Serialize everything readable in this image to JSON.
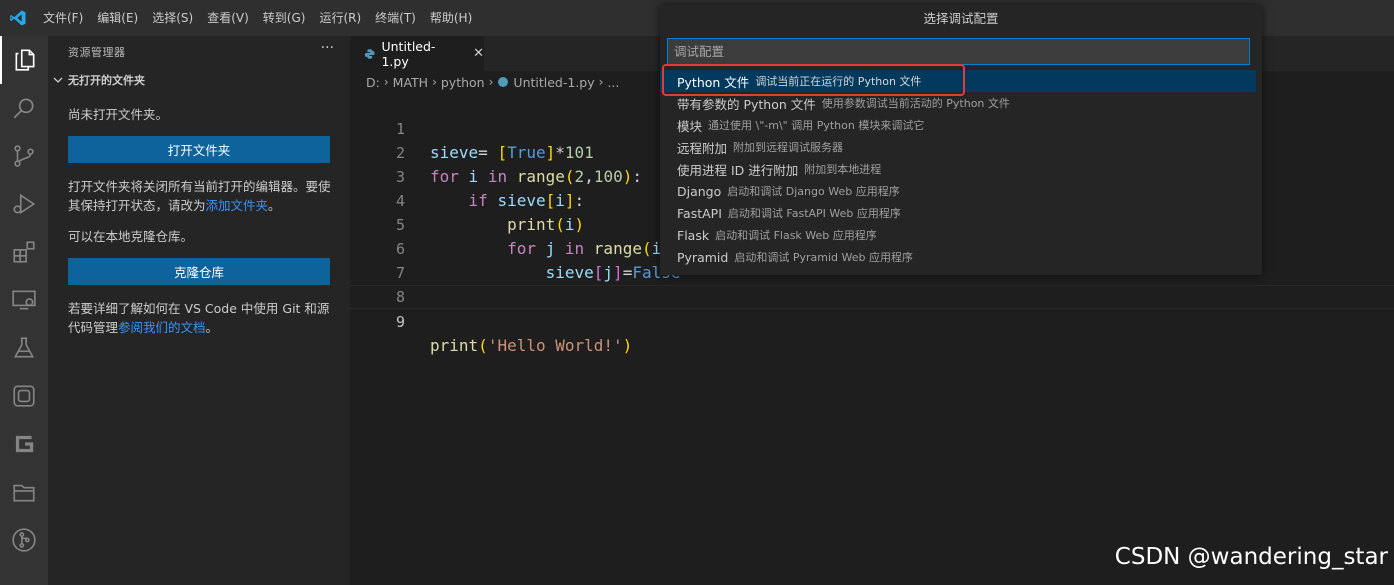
{
  "menu": [
    "文件(F)",
    "编辑(E)",
    "选择(S)",
    "查看(V)",
    "转到(G)",
    "运行(R)",
    "终端(T)",
    "帮助(H)"
  ],
  "activity_bar": [
    "explorer-icon",
    "search-icon",
    "source-control-icon",
    "run-debug-icon",
    "extensions-icon",
    "remote-explorer-icon",
    "testing-icon",
    "box-icon",
    "gitlens-icon",
    "folder-icon",
    "git-graph-icon"
  ],
  "sidebar": {
    "header": "资源管理器",
    "more": "···",
    "section": "无打开的文件夹",
    "no_folder_text": "尚未打开文件夹。",
    "open_folder_button": "打开文件夹",
    "open_folder_info": "打开文件夹将关闭所有当前打开的编辑器。要使其保持打开状态，请改为",
    "add_folder_link": "添加文件夹",
    "period": "。",
    "clone_text": "可以在本地克隆仓库。",
    "clone_button": "克隆仓库",
    "git_info": "若要详细了解如何在 VS Code 中使用 Git 和源代码管理",
    "docs_link": "参阅我们的文档",
    "period2": "。"
  },
  "tab": {
    "title": "Untitled-1.py",
    "close": "✕"
  },
  "breadcrumb": [
    "D:",
    "MATH",
    "python",
    "Untitled-1.py",
    "..."
  ],
  "code": {
    "line_numbers": [
      "1",
      "2",
      "3",
      "4",
      "5",
      "6",
      "7",
      "8",
      "9"
    ],
    "current_line": 9
  },
  "quick_pick": {
    "title": "选择调试配置",
    "placeholder": "调试配置",
    "items": [
      {
        "label": "Python 文件",
        "description": "调试当前正在运行的 Python 文件"
      },
      {
        "label": "带有参数的 Python 文件",
        "description": "使用参数调试当前活动的 Python 文件"
      },
      {
        "label": "模块",
        "description": "通过使用 \\\"-m\\\" 调用 Python 模块来调试它"
      },
      {
        "label": "远程附加",
        "description": "附加到远程调试服务器"
      },
      {
        "label": "使用进程 ID 进行附加",
        "description": "附加到本地进程"
      },
      {
        "label": "Django",
        "description": "启动和调试 Django Web 应用程序"
      },
      {
        "label": "FastAPI",
        "description": "启动和调试 FastAPI Web 应用程序"
      },
      {
        "label": "Flask",
        "description": "启动和调试 Flask Web 应用程序"
      },
      {
        "label": "Pyramid",
        "description": "启动和调试 Pyramid Web 应用程序"
      }
    ]
  },
  "watermark": "CSDN @wandering_star",
  "colors": {
    "accent": "#0e639c",
    "selection": "#04395e",
    "highlight": "#e03c3c",
    "link": "#3794ff"
  }
}
